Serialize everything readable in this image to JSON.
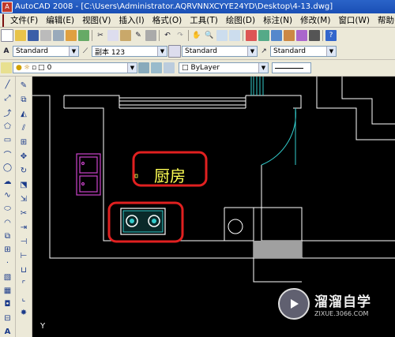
{
  "window": {
    "title": "AutoCAD 2008 - [C:\\Users\\Administrator.AQRVNNXCYYE24YD\\Desktop\\4-13.dwg]"
  },
  "menu": {
    "items": [
      "文件(F)",
      "编辑(E)",
      "视图(V)",
      "插入(I)",
      "格式(O)",
      "工具(T)",
      "绘图(D)",
      "标注(N)",
      "修改(M)",
      "窗口(W)",
      "帮助(H)"
    ]
  },
  "styles_toolbar": {
    "text_style": "Standard",
    "dim_style": "副本 123",
    "table_style": "Standard",
    "multileader_style": "Standard"
  },
  "layers_toolbar": {
    "layer_name": "0",
    "color": "ByLayer"
  },
  "drawing": {
    "room_label": "厨房",
    "ucs_axis_label": "Y"
  },
  "watermark": {
    "name": "溜溜自学",
    "url": "ZIXUE.3066.COM"
  },
  "colors": {
    "canvas_bg": "#000000",
    "walls": "#ffffff",
    "door_arc": "#33cccc",
    "fixtures": "#cc44cc",
    "highlight": "#e02020",
    "label_text": "#ffff55"
  }
}
